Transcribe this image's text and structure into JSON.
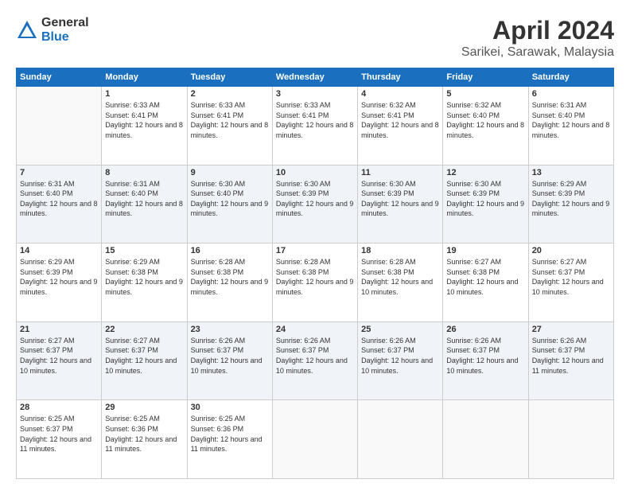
{
  "logo": {
    "general": "General",
    "blue": "Blue"
  },
  "title": "April 2024",
  "subtitle": "Sarikei, Sarawak, Malaysia",
  "days_of_week": [
    "Sunday",
    "Monday",
    "Tuesday",
    "Wednesday",
    "Thursday",
    "Friday",
    "Saturday"
  ],
  "weeks": [
    [
      {
        "day": "",
        "sunrise": "",
        "sunset": "",
        "daylight": ""
      },
      {
        "day": "1",
        "sunrise": "Sunrise: 6:33 AM",
        "sunset": "Sunset: 6:41 PM",
        "daylight": "Daylight: 12 hours and 8 minutes."
      },
      {
        "day": "2",
        "sunrise": "Sunrise: 6:33 AM",
        "sunset": "Sunset: 6:41 PM",
        "daylight": "Daylight: 12 hours and 8 minutes."
      },
      {
        "day": "3",
        "sunrise": "Sunrise: 6:33 AM",
        "sunset": "Sunset: 6:41 PM",
        "daylight": "Daylight: 12 hours and 8 minutes."
      },
      {
        "day": "4",
        "sunrise": "Sunrise: 6:32 AM",
        "sunset": "Sunset: 6:41 PM",
        "daylight": "Daylight: 12 hours and 8 minutes."
      },
      {
        "day": "5",
        "sunrise": "Sunrise: 6:32 AM",
        "sunset": "Sunset: 6:40 PM",
        "daylight": "Daylight: 12 hours and 8 minutes."
      },
      {
        "day": "6",
        "sunrise": "Sunrise: 6:31 AM",
        "sunset": "Sunset: 6:40 PM",
        "daylight": "Daylight: 12 hours and 8 minutes."
      }
    ],
    [
      {
        "day": "7",
        "sunrise": "Sunrise: 6:31 AM",
        "sunset": "Sunset: 6:40 PM",
        "daylight": "Daylight: 12 hours and 8 minutes."
      },
      {
        "day": "8",
        "sunrise": "Sunrise: 6:31 AM",
        "sunset": "Sunset: 6:40 PM",
        "daylight": "Daylight: 12 hours and 8 minutes."
      },
      {
        "day": "9",
        "sunrise": "Sunrise: 6:30 AM",
        "sunset": "Sunset: 6:40 PM",
        "daylight": "Daylight: 12 hours and 9 minutes."
      },
      {
        "day": "10",
        "sunrise": "Sunrise: 6:30 AM",
        "sunset": "Sunset: 6:39 PM",
        "daylight": "Daylight: 12 hours and 9 minutes."
      },
      {
        "day": "11",
        "sunrise": "Sunrise: 6:30 AM",
        "sunset": "Sunset: 6:39 PM",
        "daylight": "Daylight: 12 hours and 9 minutes."
      },
      {
        "day": "12",
        "sunrise": "Sunrise: 6:30 AM",
        "sunset": "Sunset: 6:39 PM",
        "daylight": "Daylight: 12 hours and 9 minutes."
      },
      {
        "day": "13",
        "sunrise": "Sunrise: 6:29 AM",
        "sunset": "Sunset: 6:39 PM",
        "daylight": "Daylight: 12 hours and 9 minutes."
      }
    ],
    [
      {
        "day": "14",
        "sunrise": "Sunrise: 6:29 AM",
        "sunset": "Sunset: 6:39 PM",
        "daylight": "Daylight: 12 hours and 9 minutes."
      },
      {
        "day": "15",
        "sunrise": "Sunrise: 6:29 AM",
        "sunset": "Sunset: 6:38 PM",
        "daylight": "Daylight: 12 hours and 9 minutes."
      },
      {
        "day": "16",
        "sunrise": "Sunrise: 6:28 AM",
        "sunset": "Sunset: 6:38 PM",
        "daylight": "Daylight: 12 hours and 9 minutes."
      },
      {
        "day": "17",
        "sunrise": "Sunrise: 6:28 AM",
        "sunset": "Sunset: 6:38 PM",
        "daylight": "Daylight: 12 hours and 9 minutes."
      },
      {
        "day": "18",
        "sunrise": "Sunrise: 6:28 AM",
        "sunset": "Sunset: 6:38 PM",
        "daylight": "Daylight: 12 hours and 10 minutes."
      },
      {
        "day": "19",
        "sunrise": "Sunrise: 6:27 AM",
        "sunset": "Sunset: 6:38 PM",
        "daylight": "Daylight: 12 hours and 10 minutes."
      },
      {
        "day": "20",
        "sunrise": "Sunrise: 6:27 AM",
        "sunset": "Sunset: 6:37 PM",
        "daylight": "Daylight: 12 hours and 10 minutes."
      }
    ],
    [
      {
        "day": "21",
        "sunrise": "Sunrise: 6:27 AM",
        "sunset": "Sunset: 6:37 PM",
        "daylight": "Daylight: 12 hours and 10 minutes."
      },
      {
        "day": "22",
        "sunrise": "Sunrise: 6:27 AM",
        "sunset": "Sunset: 6:37 PM",
        "daylight": "Daylight: 12 hours and 10 minutes."
      },
      {
        "day": "23",
        "sunrise": "Sunrise: 6:26 AM",
        "sunset": "Sunset: 6:37 PM",
        "daylight": "Daylight: 12 hours and 10 minutes."
      },
      {
        "day": "24",
        "sunrise": "Sunrise: 6:26 AM",
        "sunset": "Sunset: 6:37 PM",
        "daylight": "Daylight: 12 hours and 10 minutes."
      },
      {
        "day": "25",
        "sunrise": "Sunrise: 6:26 AM",
        "sunset": "Sunset: 6:37 PM",
        "daylight": "Daylight: 12 hours and 10 minutes."
      },
      {
        "day": "26",
        "sunrise": "Sunrise: 6:26 AM",
        "sunset": "Sunset: 6:37 PM",
        "daylight": "Daylight: 12 hours and 10 minutes."
      },
      {
        "day": "27",
        "sunrise": "Sunrise: 6:26 AM",
        "sunset": "Sunset: 6:37 PM",
        "daylight": "Daylight: 12 hours and 11 minutes."
      }
    ],
    [
      {
        "day": "28",
        "sunrise": "Sunrise: 6:25 AM",
        "sunset": "Sunset: 6:37 PM",
        "daylight": "Daylight: 12 hours and 11 minutes."
      },
      {
        "day": "29",
        "sunrise": "Sunrise: 6:25 AM",
        "sunset": "Sunset: 6:36 PM",
        "daylight": "Daylight: 12 hours and 11 minutes."
      },
      {
        "day": "30",
        "sunrise": "Sunrise: 6:25 AM",
        "sunset": "Sunset: 6:36 PM",
        "daylight": "Daylight: 12 hours and 11 minutes."
      },
      {
        "day": "",
        "sunrise": "",
        "sunset": "",
        "daylight": ""
      },
      {
        "day": "",
        "sunrise": "",
        "sunset": "",
        "daylight": ""
      },
      {
        "day": "",
        "sunrise": "",
        "sunset": "",
        "daylight": ""
      },
      {
        "day": "",
        "sunrise": "",
        "sunset": "",
        "daylight": ""
      }
    ]
  ]
}
